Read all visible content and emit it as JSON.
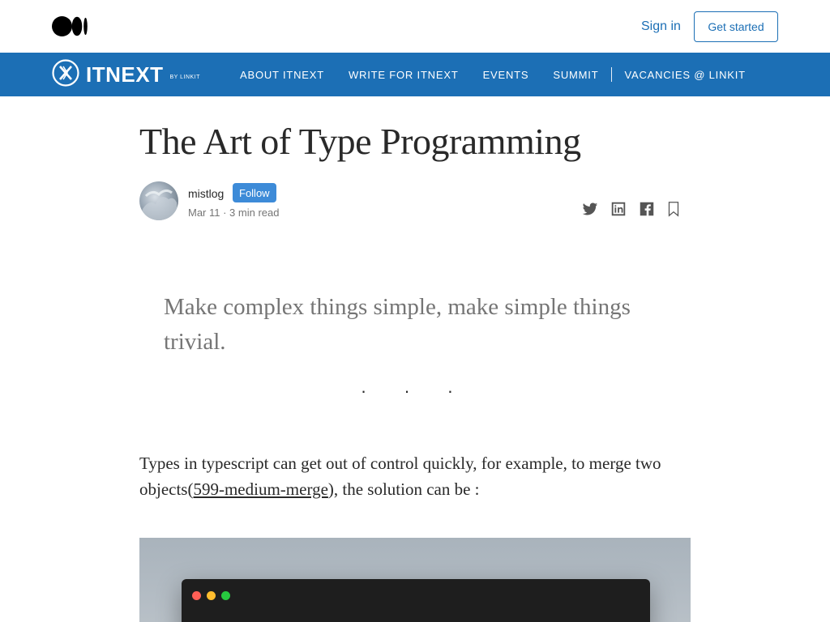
{
  "header": {
    "sign_in": "Sign in",
    "get_started": "Get started"
  },
  "publication": {
    "name": "ITNEXT",
    "sub": "BY LINKIT",
    "nav": [
      {
        "label": "ABOUT ITNEXT"
      },
      {
        "label": "WRITE FOR ITNEXT"
      },
      {
        "label": "EVENTS"
      },
      {
        "label": "SUMMIT"
      },
      {
        "label": "VACANCIES @ LINKIT"
      }
    ]
  },
  "article": {
    "title": "The Art of Type Programming",
    "author": "mistlog",
    "follow": "Follow",
    "meta": "Mar 11 · 3 min read",
    "quote": "Make complex things simple, make simple things trivial.",
    "separator": "· · ·",
    "para_before": "Types in typescript can get out of control quickly, for example, to merge two objects(",
    "para_link": "599-medium-merge",
    "para_after": "), the solution can be :"
  },
  "colors": {
    "brand": "#1c6fb5",
    "follow": "#3d8bd8"
  },
  "icons": [
    "medium-logo-icon",
    "itnext-logo-icon",
    "twitter-icon",
    "linkedin-icon",
    "facebook-icon",
    "bookmark-icon"
  ]
}
